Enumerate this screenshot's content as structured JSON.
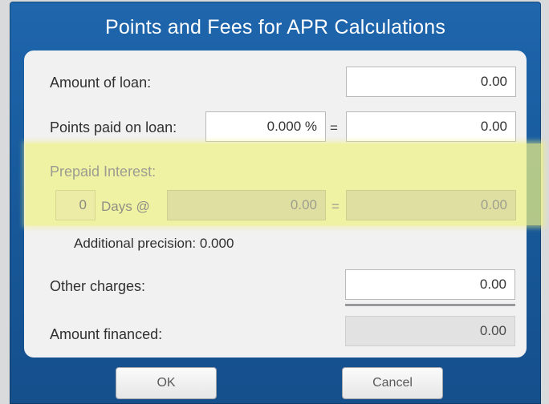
{
  "dialog": {
    "title": "Points and Fees for APR Calculations",
    "amount_of_loan": {
      "label": "Amount of loan:",
      "value": "0.00"
    },
    "points": {
      "label": "Points paid on loan:",
      "percent_value": "0.000 %",
      "equals": "=",
      "value": "0.00"
    },
    "prepaid_interest": {
      "label": "Prepaid Interest:",
      "days_value": "0",
      "days_label": "Days @",
      "rate_value": "0.00",
      "equals": "=",
      "value": "0.00"
    },
    "additional_precision": "Additional precision:  0.000",
    "other_charges": {
      "label": "Other charges:",
      "value": "0.00"
    },
    "amount_financed": {
      "label": "Amount financed:",
      "value": "0.00"
    },
    "buttons": {
      "ok": "OK",
      "cancel": "Cancel"
    }
  },
  "colors": {
    "dialog_blue": "#1f66ad",
    "highlight_yellow": "#eff282"
  }
}
